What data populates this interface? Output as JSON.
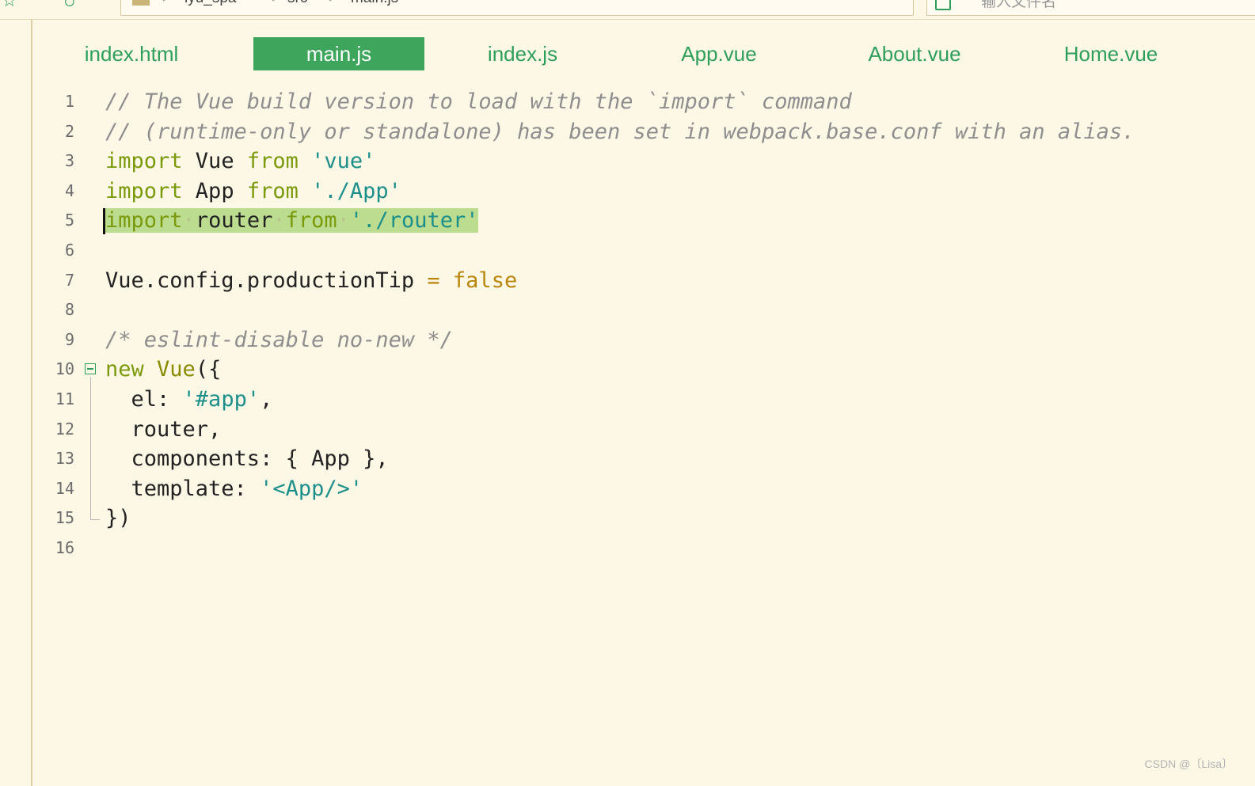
{
  "breadcrumb": {
    "items": [
      "lyu_spa",
      "src",
      "main.js"
    ],
    "separator": ">"
  },
  "search": {
    "placeholder": "输入文件名"
  },
  "tabs": [
    {
      "label": "index.html",
      "active": false
    },
    {
      "label": "main.js",
      "active": true
    },
    {
      "label": "index.js",
      "active": false
    },
    {
      "label": "App.vue",
      "active": false
    },
    {
      "label": "About.vue",
      "active": false
    },
    {
      "label": "Home.vue",
      "active": false
    }
  ],
  "editor": {
    "line_numbers": [
      "1",
      "2",
      "3",
      "4",
      "5",
      "6",
      "7",
      "8",
      "9",
      "10",
      "11",
      "12",
      "13",
      "14",
      "15",
      "16"
    ],
    "lines": [
      {
        "tokens": [
          {
            "t": "cm",
            "v": "// The Vue build version to load with the `import` command"
          }
        ]
      },
      {
        "tokens": [
          {
            "t": "cm",
            "v": "// (runtime-only or standalone) has been set in webpack.base.conf with an alias."
          }
        ]
      },
      {
        "tokens": [
          {
            "t": "kw",
            "v": "import"
          },
          {
            "t": "id",
            "v": " Vue "
          },
          {
            "t": "kw",
            "v": "from"
          },
          {
            "t": "id",
            "v": " "
          },
          {
            "t": "str",
            "v": "'vue'"
          }
        ]
      },
      {
        "tokens": [
          {
            "t": "kw",
            "v": "import"
          },
          {
            "t": "id",
            "v": " App "
          },
          {
            "t": "kw",
            "v": "from"
          },
          {
            "t": "id",
            "v": " "
          },
          {
            "t": "str",
            "v": "'./App'"
          }
        ]
      },
      {
        "tokens": [
          {
            "t": "kw",
            "v": "import"
          },
          {
            "t": "dot",
            "v": "·"
          },
          {
            "t": "id",
            "v": "router"
          },
          {
            "t": "dot",
            "v": "·"
          },
          {
            "t": "kw",
            "v": "from"
          },
          {
            "t": "dot",
            "v": "·"
          },
          {
            "t": "str",
            "v": "'./router'"
          }
        ],
        "highlight": true,
        "cursor": true
      },
      {
        "tokens": []
      },
      {
        "tokens": [
          {
            "t": "id",
            "v": "Vue.config.productionTip "
          },
          {
            "t": "op",
            "v": "="
          },
          {
            "t": "id",
            "v": " "
          },
          {
            "t": "bool",
            "v": "false"
          }
        ]
      },
      {
        "tokens": []
      },
      {
        "tokens": [
          {
            "t": "cm",
            "v": "/* eslint-disable no-new */"
          }
        ]
      },
      {
        "tokens": [
          {
            "t": "kw",
            "v": "new"
          },
          {
            "t": "id",
            "v": " "
          },
          {
            "t": "cls",
            "v": "Vue"
          },
          {
            "t": "id",
            "v": "({"
          }
        ]
      },
      {
        "tokens": [
          {
            "t": "id",
            "v": "  el: "
          },
          {
            "t": "str",
            "v": "'#app'"
          },
          {
            "t": "id",
            "v": ","
          }
        ]
      },
      {
        "tokens": [
          {
            "t": "id",
            "v": "  router,"
          }
        ]
      },
      {
        "tokens": [
          {
            "t": "id",
            "v": "  components: { App },"
          }
        ]
      },
      {
        "tokens": [
          {
            "t": "id",
            "v": "  template: "
          },
          {
            "t": "str",
            "v": "'<App/>'"
          }
        ]
      },
      {
        "tokens": [
          {
            "t": "id",
            "v": "})"
          }
        ]
      },
      {
        "tokens": []
      }
    ]
  },
  "watermark": "CSDN @〔Lisa〕",
  "colors": {
    "background": "#fdf8e6",
    "accent": "#2e9e5b",
    "active_tab": "#3da65c",
    "line_highlight": "#bcdc8f"
  }
}
